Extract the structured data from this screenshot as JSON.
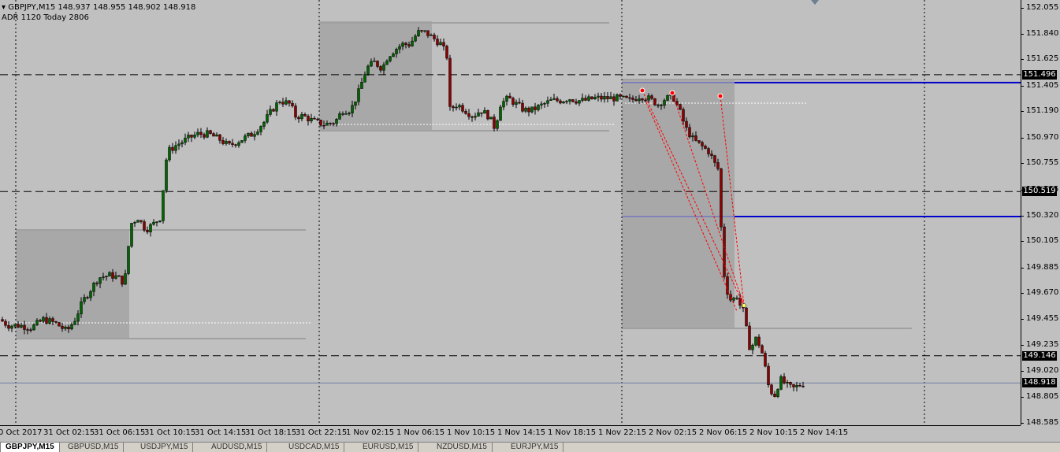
{
  "header": {
    "symbol_line": "GBPJPY,M15  148.937 148.955 148.902 148.918",
    "adr_line": "ADR 1120  Today 2806"
  },
  "price_axis": {
    "ticks": [
      "152.055",
      "151.840",
      "151.625",
      "151.405",
      "151.190",
      "150.970",
      "150.755",
      "150.535",
      "150.320",
      "150.105",
      "149.885",
      "149.670",
      "149.455",
      "149.235",
      "149.020",
      "148.805",
      "148.585"
    ],
    "tags": [
      "151.496",
      "150.519",
      "149.146",
      "148.918"
    ]
  },
  "time_axis": {
    "labels": [
      "0 Oct 2017",
      "31 Oct 02:15",
      "31 Oct 06:15",
      "31 Oct 10:15",
      "31 Oct 14:15",
      "31 Oct 18:15",
      "31 Oct 22:15",
      "1 Nov 02:15",
      "1 Nov 06:15",
      "1 Nov 10:15",
      "1 Nov 14:15",
      "1 Nov 18:15",
      "1 Nov 22:15",
      "2 Nov 02:15",
      "2 Nov 06:15",
      "2 Nov 10:15",
      "2 Nov 14:15"
    ]
  },
  "tabs": [
    "GBPJPY,M15",
    "GBPUSD,M15",
    "USDJPY,M15",
    "AUDUSD,M15",
    "USDCAD,M15",
    "EURUSD,M15",
    "NZDUSD,M15",
    "EURJPY,M15"
  ],
  "colors": {
    "background": "#c0c0c0",
    "bull_candle": "#006400",
    "bear_candle": "#8b0000",
    "level_blue": "#0000cc",
    "session_box": "#a8a8a8",
    "trend_red": "#ff0000"
  },
  "chart_data": {
    "type": "candlestick",
    "symbol": "GBPJPY",
    "timeframe": "M15",
    "last_price": 148.918,
    "ylim": [
      148.585,
      152.055
    ],
    "horizontal_levels": [
      151.496,
      150.519,
      149.146,
      148.918
    ],
    "blue_levels": [
      151.43,
      150.31
    ],
    "path": [
      [
        0,
        149.45
      ],
      [
        10,
        149.4
      ],
      [
        25,
        149.4
      ],
      [
        40,
        149.38
      ],
      [
        55,
        149.45
      ],
      [
        70,
        149.42
      ],
      [
        85,
        149.35
      ],
      [
        95,
        149.45
      ],
      [
        105,
        149.6
      ],
      [
        115,
        149.7
      ],
      [
        125,
        149.8
      ],
      [
        140,
        149.82
      ],
      [
        150,
        149.8
      ],
      [
        158,
        149.75
      ],
      [
        162,
        150.0
      ],
      [
        166,
        150.25
      ],
      [
        175,
        150.3
      ],
      [
        185,
        150.2
      ],
      [
        195,
        150.25
      ],
      [
        203,
        150.3
      ],
      [
        208,
        150.6
      ],
      [
        212,
        150.85
      ],
      [
        222,
        150.9
      ],
      [
        235,
        150.95
      ],
      [
        250,
        151.0
      ],
      [
        265,
        151.0
      ],
      [
        280,
        150.95
      ],
      [
        290,
        150.9
      ],
      [
        305,
        150.95
      ],
      [
        320,
        151.0
      ],
      [
        335,
        151.1
      ],
      [
        345,
        151.2
      ],
      [
        355,
        151.28
      ],
      [
        368,
        151.25
      ],
      [
        375,
        151.15
      ],
      [
        385,
        151.15
      ],
      [
        400,
        151.1
      ],
      [
        412,
        151.08
      ],
      [
        425,
        151.1
      ],
      [
        435,
        151.2
      ],
      [
        445,
        151.2
      ],
      [
        455,
        151.35
      ],
      [
        465,
        151.55
      ],
      [
        475,
        151.6
      ],
      [
        485,
        151.55
      ],
      [
        492,
        151.65
      ],
      [
        500,
        151.7
      ],
      [
        510,
        151.75
      ],
      [
        520,
        151.75
      ],
      [
        530,
        151.85
      ],
      [
        540,
        151.85
      ],
      [
        550,
        151.8
      ],
      [
        560,
        151.75
      ],
      [
        567,
        151.65
      ],
      [
        570,
        151.2
      ],
      [
        580,
        151.25
      ],
      [
        590,
        151.2
      ],
      [
        600,
        151.15
      ],
      [
        610,
        151.2
      ],
      [
        620,
        151.15
      ],
      [
        628,
        151.05
      ],
      [
        635,
        151.25
      ],
      [
        645,
        151.3
      ],
      [
        655,
        151.25
      ],
      [
        665,
        151.2
      ],
      [
        675,
        151.2
      ],
      [
        690,
        151.25
      ],
      [
        700,
        151.28
      ],
      [
        712,
        151.28
      ],
      [
        722,
        151.3
      ],
      [
        732,
        151.28
      ],
      [
        742,
        151.28
      ],
      [
        755,
        151.3
      ],
      [
        770,
        151.3
      ],
      [
        785,
        151.3
      ],
      [
        800,
        151.28
      ],
      [
        812,
        151.32
      ],
      [
        822,
        151.3
      ],
      [
        835,
        151.25
      ],
      [
        845,
        151.3
      ],
      [
        855,
        151.3
      ],
      [
        862,
        151.2
      ],
      [
        870,
        151.05
      ],
      [
        880,
        150.95
      ],
      [
        890,
        150.9
      ],
      [
        900,
        150.85
      ],
      [
        907,
        150.75
      ],
      [
        912,
        150.7
      ],
      [
        917,
        149.9
      ],
      [
        922,
        149.7
      ],
      [
        928,
        149.6
      ],
      [
        935,
        149.65
      ],
      [
        940,
        149.55
      ],
      [
        945,
        149.5
      ],
      [
        948,
        149.3
      ],
      [
        952,
        149.2
      ],
      [
        960,
        149.3
      ],
      [
        968,
        149.15
      ],
      [
        975,
        148.9
      ],
      [
        982,
        148.8
      ],
      [
        990,
        148.95
      ],
      [
        998,
        148.9
      ],
      [
        1006,
        148.87
      ],
      [
        1014,
        148.9
      ],
      [
        1022,
        148.918
      ]
    ]
  }
}
